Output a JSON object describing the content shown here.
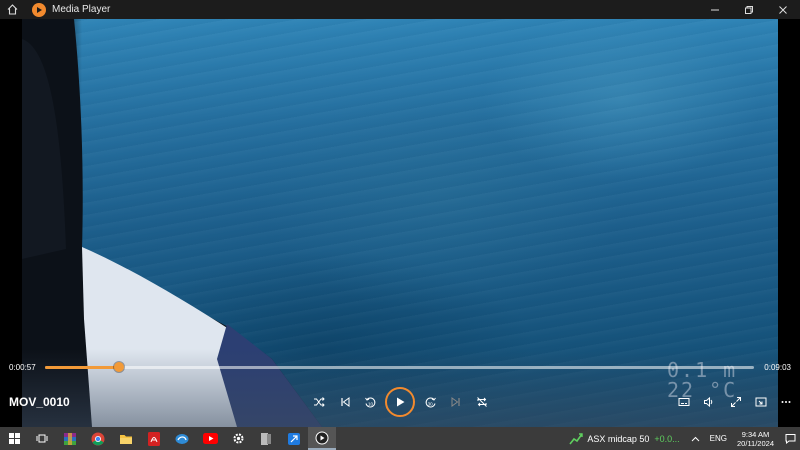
{
  "window": {
    "title": "Media Player"
  },
  "player": {
    "current_time": "0:00:57",
    "total_time": "0:09:03",
    "progress": 0.105,
    "media_title": "MOV_0010",
    "overlay_depth": "0.1 m",
    "overlay_temp": "22 °C",
    "controls": [
      "shuffle-icon",
      "previous-icon",
      "rewind-10-icon",
      "play-icon",
      "forward-30-icon",
      "next-icon",
      "repeat-off-icon",
      "captions-icon",
      "volume-icon",
      "fullscreen-icon",
      "miniplayer-icon",
      "more-icon"
    ]
  },
  "taskbar": {
    "apps": [
      "start-icon",
      "task-view-icon",
      "winrar-icon",
      "chrome-icon",
      "file-explorer-icon",
      "pdf-icon",
      "edge-legacy-icon",
      "youtube-icon",
      "settings-icon",
      "app-icon",
      "store-icon",
      "media-player-icon"
    ],
    "stock_name": "ASX midcap 50",
    "stock_change": "+0.0...",
    "language": "ENG",
    "time": "9:34 AM",
    "date": "20/11/2024"
  },
  "colors": {
    "accent": "#f28a2e",
    "titlebar": "#1c1c1c",
    "taskbar": "#3b3b3b",
    "stock_up": "#5fcf5f"
  }
}
